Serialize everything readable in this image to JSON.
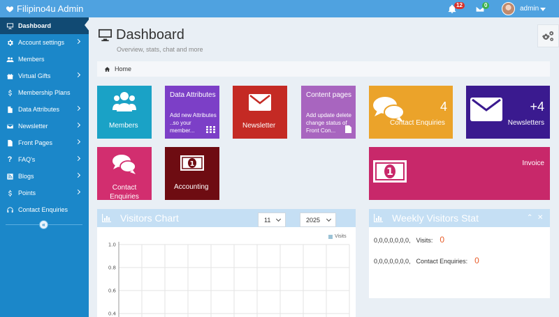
{
  "topbar": {
    "brand": "Filipino4u Admin",
    "notifications_count": "12",
    "messages_count": "0",
    "username": "admin",
    "bg_color": "#4fa2e0"
  },
  "sidebar": {
    "items": [
      {
        "label": "Dashboard",
        "icon": "monitor-icon",
        "active": true
      },
      {
        "label": "Account settings",
        "icon": "gear-icon",
        "chevron": true
      },
      {
        "label": "Members",
        "icon": "users-icon"
      },
      {
        "label": "Virtual Gifts",
        "icon": "gift-icon",
        "chevron": true
      },
      {
        "label": "Membership Plans",
        "icon": "dollar-icon"
      },
      {
        "label": "Data Attributes",
        "icon": "file-icon",
        "chevron": true
      },
      {
        "label": "Newsletter",
        "icon": "envelope-icon",
        "chevron": true
      },
      {
        "label": "Front Pages",
        "icon": "file-icon",
        "chevron": true
      },
      {
        "label": "FAQ's",
        "icon": "question-icon",
        "chevron": true
      },
      {
        "label": "Blogs",
        "icon": "rss-icon",
        "chevron": true
      },
      {
        "label": "Points",
        "icon": "dollar-icon",
        "chevron": true
      },
      {
        "label": "Contact Enquiries",
        "icon": "headset-icon"
      }
    ],
    "collapse_glyph": "«",
    "bg_color": "#1b87c9"
  },
  "header": {
    "title": "Dashboard",
    "subtitle": "Overview, stats, chat and more"
  },
  "breadcrumb": {
    "home": "Home"
  },
  "tiles": {
    "members": {
      "label": "Members",
      "color": "#1aa2c6"
    },
    "data_attributes": {
      "title": "Data Attributes",
      "desc": "Add new Attributes ..so your member...",
      "color": "#7c3fc7"
    },
    "newsletter": {
      "label": "Newsletter",
      "color": "#c42a24"
    },
    "content_pages": {
      "title": "Content pages",
      "desc": "Add update delete change status of Front Con...",
      "color": "#a865bf"
    },
    "contact_enquiries_count": {
      "value": "4",
      "label": "Contact Enquiries",
      "color": "#eba32a"
    },
    "newsletters_count": {
      "value": "+4",
      "label": "Newsletters",
      "color": "#3a1a8f"
    },
    "contact_enquiries": {
      "label": "Contact Enquiries",
      "color": "#d22e6f"
    },
    "accounting": {
      "label": "Accounting",
      "color": "#6e0c12"
    },
    "invoice": {
      "label": "Invoice",
      "color": "#c8286a"
    }
  },
  "visitors_chart": {
    "title": "Visitors Chart",
    "month_select": "11",
    "year_select": "2025",
    "legend": "Visits"
  },
  "chart_data": {
    "type": "bar",
    "categories": [],
    "series": [
      {
        "name": "Visits",
        "values": []
      }
    ],
    "ylim": [
      0,
      1.0
    ],
    "yticks": [
      "1.0",
      "0.8",
      "0.6",
      "0.4"
    ],
    "grid": true,
    "legend_position": "top-right"
  },
  "weekly_stat": {
    "title": "Weekly Visitors Stat",
    "visits_series": "0,0,0,0,0,0,0,",
    "visits_label": "Visits:",
    "visits_value": "0",
    "enquiries_series": "0,0,0,0,0,0,0,",
    "enquiries_label": "Contact Enquiries:",
    "enquiries_value": "0",
    "collapse_glyph": "⌃",
    "close_glyph": "✕"
  }
}
